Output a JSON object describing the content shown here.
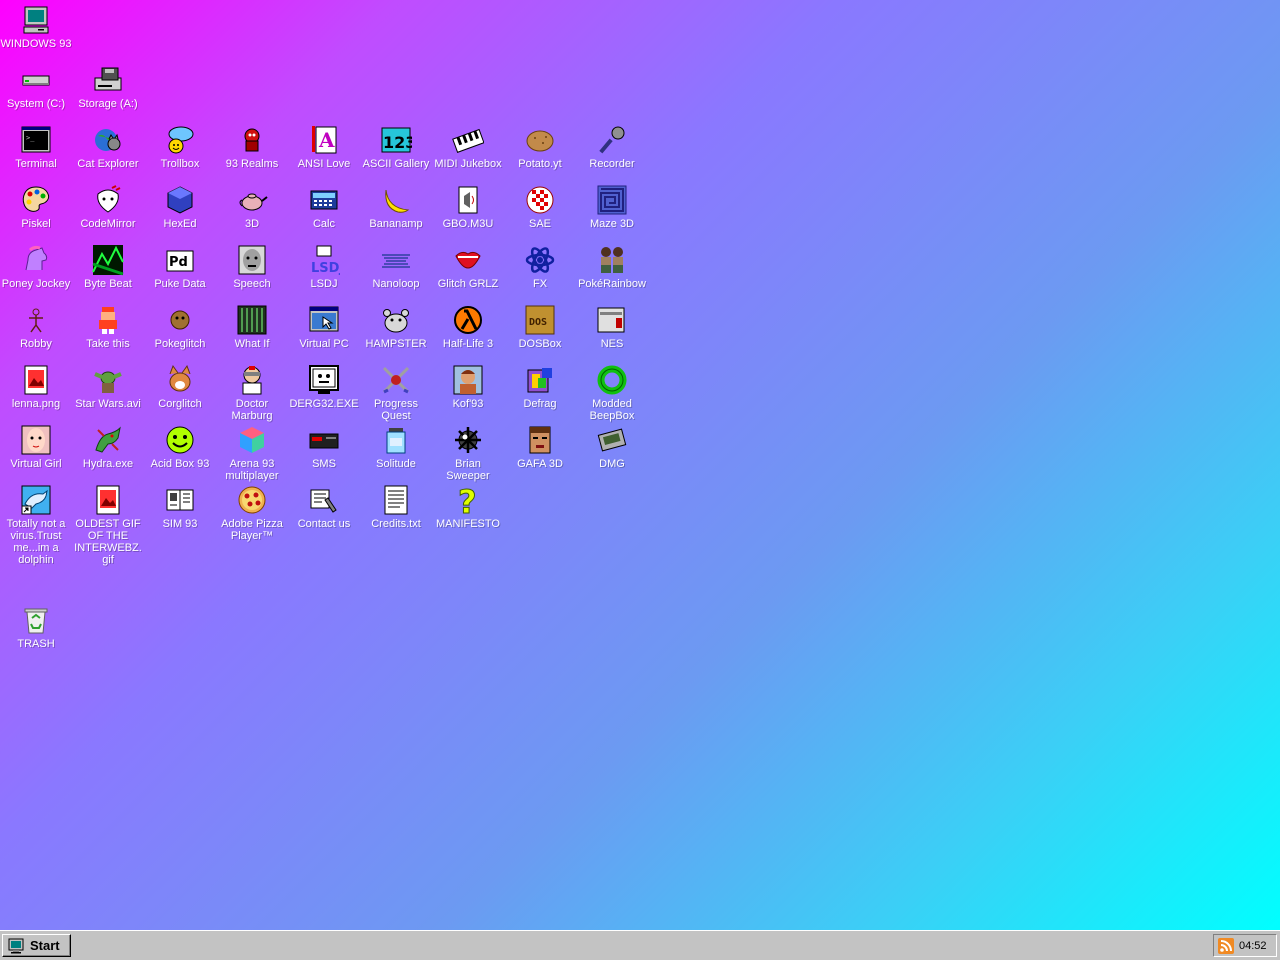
{
  "desktop": {
    "icons": [
      {
        "label": "WINDOWS 93",
        "icon": "computer-icon"
      },
      {
        "label": "System (C:)",
        "icon": "drive-icon"
      },
      {
        "label": "Storage (A:)",
        "icon": "floppy-drive-icon"
      },
      {
        "label": "Terminal",
        "icon": "terminal-icon"
      },
      {
        "label": "Cat Explorer",
        "icon": "cat-globe-icon"
      },
      {
        "label": "Trollbox",
        "icon": "chat-bubble-icon"
      },
      {
        "label": "93 Realms",
        "icon": "red-creature-icon"
      },
      {
        "label": "ANSI Love",
        "icon": "letter-a-icon"
      },
      {
        "label": "ASCII Gallery",
        "icon": "numbers-icon"
      },
      {
        "label": "MIDI Jukebox",
        "icon": "piano-keys-icon"
      },
      {
        "label": "Potato.yt",
        "icon": "potato-icon"
      },
      {
        "label": "Recorder",
        "icon": "microphone-icon"
      },
      {
        "label": "Piskel",
        "icon": "palette-icon"
      },
      {
        "label": "CodeMirror",
        "icon": "codemirror-icon"
      },
      {
        "label": "HexEd",
        "icon": "hexagon-icon"
      },
      {
        "label": "3D",
        "icon": "teapot-icon"
      },
      {
        "label": "Calc",
        "icon": "calculator-icon"
      },
      {
        "label": "Bananamp",
        "icon": "banana-icon"
      },
      {
        "label": "GBO.M3U",
        "icon": "playlist-icon"
      },
      {
        "label": "SAE",
        "icon": "checker-ball-icon"
      },
      {
        "label": "Maze 3D",
        "icon": "maze-icon"
      },
      {
        "label": "Poney Jockey",
        "icon": "pony-icon"
      },
      {
        "label": "Byte Beat",
        "icon": "waveform-icon"
      },
      {
        "label": "Puke Data",
        "icon": "pd-icon"
      },
      {
        "label": "Speech",
        "icon": "face-icon"
      },
      {
        "label": "LSDJ",
        "icon": "lsdj-icon"
      },
      {
        "label": "Nanoloop",
        "icon": "wave-lines-icon"
      },
      {
        "label": "Glitch GRLZ",
        "icon": "lips-icon"
      },
      {
        "label": "FX",
        "icon": "atom-icon"
      },
      {
        "label": "PokéRainbow",
        "icon": "characters-icon"
      },
      {
        "label": "Robby",
        "icon": "stick-figure-icon"
      },
      {
        "label": "Take this",
        "icon": "pixel-guy-icon"
      },
      {
        "label": "Pokeglitch",
        "icon": "pokeglitch-icon"
      },
      {
        "label": "What If",
        "icon": "matrix-icon"
      },
      {
        "label": "Virtual PC",
        "icon": "window-cursor-icon"
      },
      {
        "label": "HAMPSTER",
        "icon": "hamster-icon"
      },
      {
        "label": "Half-Life 3",
        "icon": "lambda-icon"
      },
      {
        "label": "DOSBox",
        "icon": "dosbox-icon"
      },
      {
        "label": "NES",
        "icon": "nes-console-icon"
      },
      {
        "label": "lenna.png",
        "icon": "image-file-icon"
      },
      {
        "label": "Star Wars.avi",
        "icon": "yoda-icon"
      },
      {
        "label": "Corglitch",
        "icon": "corgi-icon"
      },
      {
        "label": "Doctor Marburg",
        "icon": "doctor-icon"
      },
      {
        "label": "DERG32.EXE",
        "icon": "monitor-face-icon"
      },
      {
        "label": "Progress Quest",
        "icon": "swords-icon"
      },
      {
        "label": "Kof'93",
        "icon": "fighter-portrait-icon"
      },
      {
        "label": "Defrag",
        "icon": "defrag-icon"
      },
      {
        "label": "Modded BeepBox",
        "icon": "green-ring-icon"
      },
      {
        "label": "Virtual Girl",
        "icon": "girl-portrait-icon"
      },
      {
        "label": "Hydra.exe",
        "icon": "dragon-icon"
      },
      {
        "label": "Acid Box 93",
        "icon": "smiley-icon"
      },
      {
        "label": "Arena 93 multiplayer",
        "icon": "cube-icon"
      },
      {
        "label": "SMS",
        "icon": "sms-console-icon"
      },
      {
        "label": "Solitude",
        "icon": "jar-icon"
      },
      {
        "label": "Brian Sweeper",
        "icon": "mine-icon"
      },
      {
        "label": "GAFA 3D",
        "icon": "marine-face-icon"
      },
      {
        "label": "DMG",
        "icon": "gameboy-icon"
      },
      {
        "label": "Totally not a virus.Trust me...im a dolphin",
        "icon": "dolphin-icon"
      },
      {
        "label": "OLDEST GIF OF THE INTERWEBZ.gif",
        "icon": "gif-file-icon"
      },
      {
        "label": "SIM 93",
        "icon": "book-icon"
      },
      {
        "label": "Adobe Pizza Player™",
        "icon": "pizza-icon"
      },
      {
        "label": "Contact us",
        "icon": "contact-icon"
      },
      {
        "label": "Credits.txt",
        "icon": "text-file-icon"
      },
      {
        "label": "MANIFESTO",
        "icon": "question-mark-icon"
      },
      {
        "label": "TRASH",
        "icon": "recycle-bin-icon"
      }
    ]
  },
  "taskbar": {
    "start_label": "Start",
    "clock": "04:52",
    "tray_icon": "rss-icon"
  },
  "colors": {
    "gradient_top_left": "#ff00ff",
    "gradient_bottom_right": "#00ffff",
    "taskbar": "#c3c3c3",
    "label_text": "#ffffff"
  }
}
